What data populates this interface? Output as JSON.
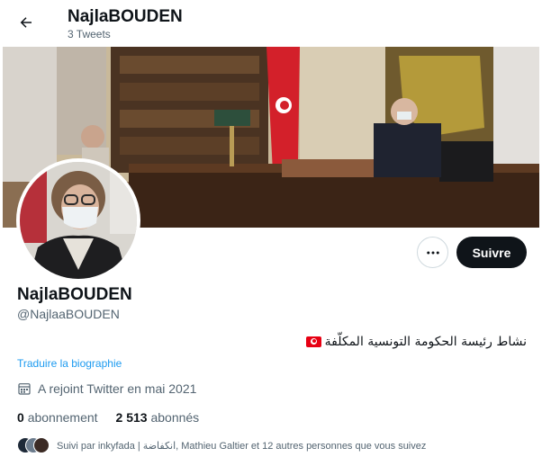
{
  "header": {
    "title": "NajlaBOUDEN",
    "tweet_count": "3 Tweets"
  },
  "profile": {
    "name": "NajlaBOUDEN",
    "handle": "@NajlaaBOUDEN",
    "bio": "نشاط رئيسة الحكومة التونسية المكلّفة",
    "bio_flag": "tunisia-flag-icon",
    "translate_link": "Traduire la biographie",
    "joined": "A rejoint Twitter en mai 2021",
    "following_count": "0",
    "following_label": "abonnement",
    "followers_count": "2 513",
    "followers_label": "abonnés",
    "followed_by": "Suivi par inkyfada | انكفاضة, Mathieu Galtier et 12 autres personnes que vous suivez"
  },
  "actions": {
    "follow_label": "Suivre",
    "more_icon": "more-icon",
    "back_icon": "back-arrow-icon"
  },
  "colors": {
    "accent": "#1d9bf0",
    "button_dark": "#0f1419",
    "secondary_text": "#536471"
  }
}
